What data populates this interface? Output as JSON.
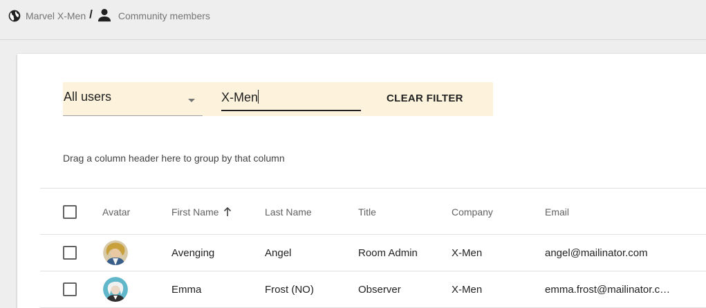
{
  "breadcrumb": {
    "community": "Marvel X-Men",
    "separator": "/",
    "page": "Community members"
  },
  "filters": {
    "user_select_value": "All users",
    "search_value": "X-Men",
    "clear_label": "CLEAR FILTER"
  },
  "grid": {
    "group_hint": "Drag a column header here to group by that column",
    "columns": {
      "avatar": "Avatar",
      "first_name": "First Name",
      "last_name": "Last Name",
      "title": "Title",
      "company": "Company",
      "email": "Email"
    },
    "sort": {
      "column": "first_name",
      "direction": "ascending"
    },
    "rows": [
      {
        "first_name": "Avenging",
        "last_name": "Angel",
        "title": "Room Admin",
        "company": "X-Men",
        "email": "angel@mailinator.com",
        "avatar_bg": "#d8c9a8"
      },
      {
        "first_name": "Emma",
        "last_name": "Frost (NO)",
        "title": "Observer",
        "company": "X-Men",
        "email": "emma.frost@mailinator.c…",
        "avatar_bg": "#5fb7c9"
      }
    ]
  },
  "colors": {
    "page_bg": "#eeeeee",
    "filter_bar_bg": "#fdf3dc",
    "card_bg": "#ffffff"
  }
}
